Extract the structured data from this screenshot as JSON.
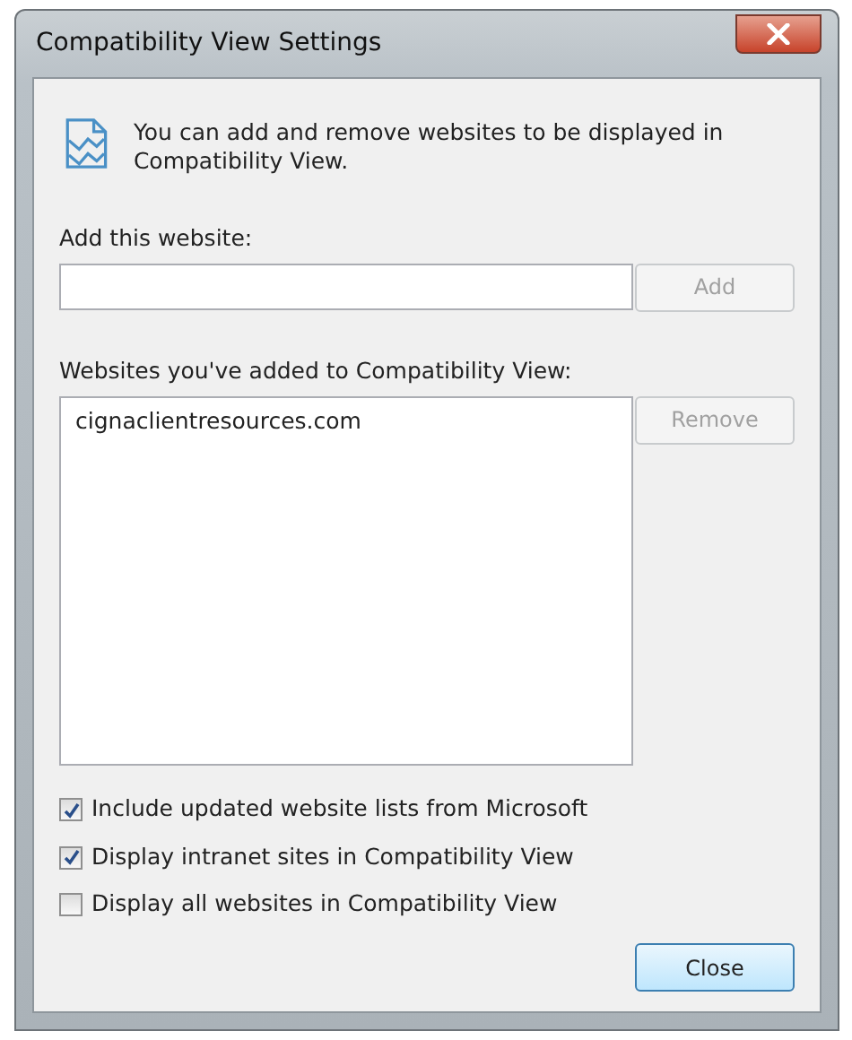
{
  "window": {
    "title": "Compatibility View Settings"
  },
  "intro": "You can add and remove websites to be displayed in Compatibility View.",
  "add_website": {
    "label": "Add this website:",
    "button": {
      "label": "Add",
      "disabled": true
    }
  },
  "added_websites": {
    "label": "Websites you've added to Compatibility View:",
    "items": [
      {
        "text": "cignaclientresources.com",
        "selected": false
      }
    ],
    "button": {
      "label": "Remove",
      "disabled": true
    }
  },
  "options": [
    {
      "label": "Include updated website lists from Microsoft",
      "checked": true
    },
    {
      "label": "Display intranet sites in Compatibility View",
      "checked": true
    },
    {
      "label": "Display all websites in Compatibility View",
      "checked": false
    }
  ],
  "close_button": {
    "label": "Close",
    "disabled": false
  }
}
